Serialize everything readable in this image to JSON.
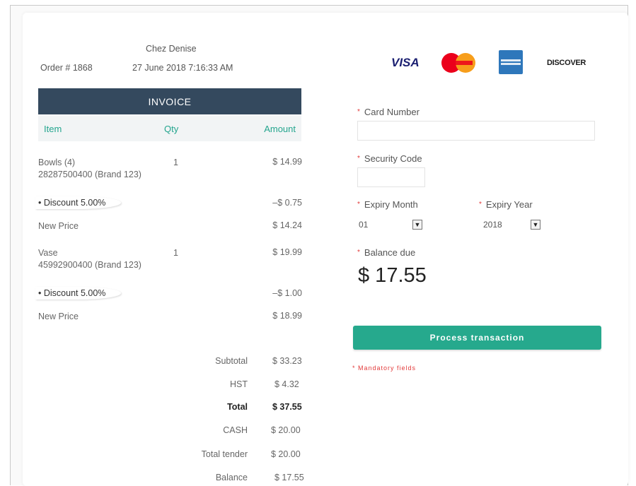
{
  "header": {
    "store_name": "Chez Denise",
    "order_number": "Order # 1868",
    "datetime": "27 June 2018 7:16:33 AM"
  },
  "card_logos": [
    {
      "name": "VISA",
      "color": "#1a1f71"
    },
    {
      "name": "MasterCard",
      "color": "#eb001b"
    },
    {
      "name": "AMERICAN EXPRESS",
      "color": "#2e77bb"
    },
    {
      "name": "DISCOVER",
      "color": "#1a1a1a"
    }
  ],
  "invoice": {
    "title": "INVOICE",
    "columns": {
      "item": "Item",
      "qty": "Qty",
      "amount": "Amount"
    },
    "items": [
      {
        "name": "Bowls (4)",
        "sku": "28287500400 (Brand 123)",
        "qty": "1",
        "amount": "$ 14.99",
        "discount_label": "Discount 5.00%",
        "discount_amount": "–$ 0.75",
        "new_price_label": "New Price",
        "new_price": "$ 14.24"
      },
      {
        "name": "Vase",
        "sku": "45992900400 (Brand 123)",
        "qty": "1",
        "amount": "$ 19.99",
        "discount_label": "Discount 5.00%",
        "discount_amount": "–$ 1.00",
        "new_price_label": "New Price",
        "new_price": "$ 18.99"
      }
    ],
    "totals": [
      {
        "label": "Subtotal",
        "value": "$ 33.23",
        "bold": false
      },
      {
        "label": "HST",
        "value": "$ 4.32",
        "bold": false
      },
      {
        "label": "Total",
        "value": "$ 37.55",
        "bold": true
      },
      {
        "label": "CASH",
        "value": "$ 20.00",
        "bold": false
      },
      {
        "label": "Total tender",
        "value": "$ 20.00",
        "bold": false
      },
      {
        "label": "Balance",
        "value": "$ 17.55",
        "bold": false
      }
    ]
  },
  "payment": {
    "required_marker": "*",
    "card_number_label": "Card Number",
    "card_number_value": "",
    "security_code_label": "Security Code",
    "security_code_value": "",
    "expiry_month_label": "Expiry Month",
    "expiry_month_value": "01",
    "expiry_year_label": "Expiry Year",
    "expiry_year_value": "2018",
    "balance_due_label": "Balance due",
    "balance_due_value": "$ 17.55",
    "process_button": "Process transaction",
    "mandatory_note": "* Mandatory fields"
  },
  "colors": {
    "accent": "#26a98d",
    "invoice_header": "#34495e",
    "required": "#e23b3b"
  }
}
